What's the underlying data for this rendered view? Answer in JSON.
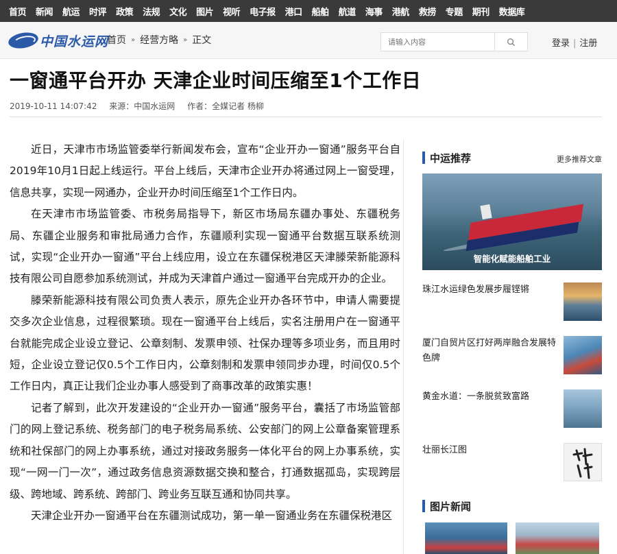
{
  "nav": [
    "首页",
    "新闻",
    "航运",
    "时评",
    "政策",
    "法规",
    "文化",
    "图片",
    "视听",
    "电子报",
    "港口",
    "船舶",
    "航道",
    "海事",
    "港航",
    "救捞",
    "专题",
    "期刊",
    "数据库"
  ],
  "header": {
    "logo_text": "中国水运网",
    "breadcrumb": [
      "首页",
      "经营方略",
      "正文"
    ],
    "search_placeholder": "请输入内容",
    "login": "登录",
    "auth_separator": "|",
    "register": "注册"
  },
  "article": {
    "title": "一窗通平台开办  天津企业时间压缩至1个工作日",
    "date": "2019-10-11 14:07:42",
    "source": "来源：中国水运网",
    "author": "作者：全媒记者 杨柳",
    "paragraphs": [
      "近日，天津市市场监管委举行新闻发布会，宣布“企业开办一窗通”服务平台自2019年10月1日起上线运行。平台上线后，天津市企业开办将通过网上一窗受理，信息共享，实现一网通办，企业开办时间压缩至1个工作日内。",
      "在天津市市场监管委、市税务局指导下，新区市场局东疆办事处、东疆税务局、东疆企业服务和审批局通力合作，东疆顺利实现一窗通平台数据互联系统测试，实现“企业开办一窗通”平台上线应用，设立在东疆保税港区天津滕荣新能源科技有限公司自愿参加系统测试，并成为天津首户通过一窗通平台完成开办的企业。",
      "滕荣新能源科技有限公司负责人表示，原先企业开办各环节中，申请人需要提交多次企业信息，过程很繁琐。现在一窗通平台上线后，实名注册用户在一窗通平台就能完成企业设立登记、公章刻制、发票申领、社保办理等多项业务，而且用时短，企业设立登记仅0.5个工作日内，公章刻制和发票申领同步办理，时间仅0.5个工作日内，真正让我们企业办事人感受到了商事改革的政策实惠！",
      "记者了解到，此次开发建设的“企业开办一窗通”服务平台，囊括了市场监管部门的网上登记系统、税务部门的电子税务局系统、公安部门的网上公章备案管理系统和社保部门的网上办事系统，通过对接政务服务一体化平台的网上办事系统，实现“一网一门一次”，通过政务信息资源数据交换和整合，打通数据孤岛，实现跨层级、跨地域、跨系统、跨部门、跨业务互联互通和协同共享。",
      "天津企业开办一窗通平台在东疆测试成功，第一单一窗通业务在东疆保税港区"
    ]
  },
  "sidebar": {
    "recommend_title": "中运推荐",
    "more": "更多推荐文章",
    "hero_caption": "智能化赋能船舶工业",
    "news": [
      {
        "title": "珠江水运绿色发展步履铿锵"
      },
      {
        "title": "厦门自贸片区打好两岸融合发展特色牌"
      },
      {
        "title": "黄金水道：一条脱贫致富路"
      },
      {
        "title": "壮丽长江图"
      }
    ],
    "photo_title": "图片新闻"
  },
  "colors": {
    "topnav": "#3a3a3a",
    "brand": "#2a5aa8",
    "ship": "#c8283a"
  }
}
